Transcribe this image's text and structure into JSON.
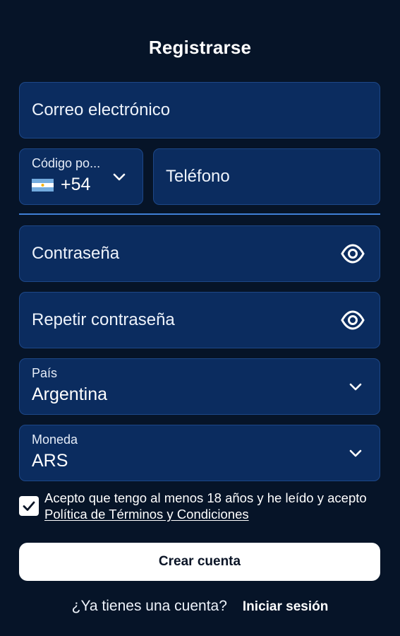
{
  "page": {
    "title": "Registrarse"
  },
  "form": {
    "email": {
      "placeholder": "Correo electrónico"
    },
    "phone_code": {
      "label": "Código po...",
      "value": "+54",
      "flag": "argentina-flag-icon"
    },
    "phone": {
      "placeholder": "Teléfono"
    },
    "password": {
      "placeholder": "Contraseña",
      "icon": "eye-icon"
    },
    "repeat_password": {
      "placeholder": "Repetir contraseña",
      "icon": "eye-icon"
    },
    "country": {
      "label": "País",
      "value": "Argentina",
      "icon": "chevron-down-icon"
    },
    "currency": {
      "label": "Moneda",
      "value": "ARS",
      "icon": "chevron-down-icon"
    },
    "terms": {
      "checked": true,
      "text": "Acepto que tengo al menos 18 años y he leído y acepto ",
      "link": "Política de Términos y Condiciones"
    }
  },
  "actions": {
    "create_account": "Crear cuenta",
    "have_account": "¿Ya tienes una cuenta?",
    "login": "Iniciar sesión"
  },
  "colors": {
    "background": "#061428",
    "field": "#0b2c5f",
    "divider": "#3f7fd6",
    "button": "#ffffff"
  }
}
